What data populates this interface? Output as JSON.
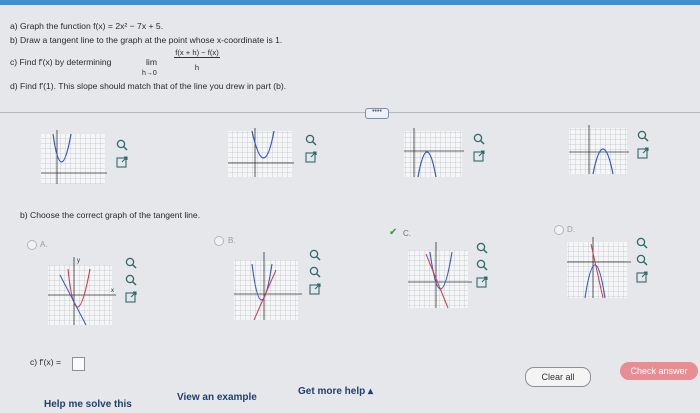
{
  "question": {
    "part_a": "a) Graph the function f(x) = 2x² − 7x + 5.",
    "part_b": "b) Draw a tangent line to the graph at the point whose x-coordinate is 1.",
    "part_c_prefix": "c) Find f′(x) by determining",
    "part_c_lim": "lim",
    "part_c_numerator": "f(x + h) − f(x)",
    "part_c_denominator": "h",
    "part_c_sub": "h→0",
    "part_d": "d) Find f′(1). This slope should match that of the line you drew in part (b)."
  },
  "dots_label": "••••",
  "part_b_prompt": "b) Choose the correct graph of the tangent line.",
  "options": [
    {
      "label": "A.",
      "selected": false
    },
    {
      "label": "B.",
      "selected": false
    },
    {
      "label": "C.",
      "selected": true
    },
    {
      "label": "D.",
      "selected": false
    }
  ],
  "check_mark": "✔",
  "axis_x": "x",
  "axis_y": "y",
  "part_c_answer_label": "c) f′(x) =",
  "buttons": {
    "clear_all": "Clear all",
    "check_answer": "Check answer"
  },
  "links": {
    "help_me_solve": "Help me solve this",
    "view_example": "View an example",
    "get_more_help": "Get more help ▴"
  },
  "icons": [
    "zoom-in-icon",
    "zoom-out-icon",
    "open-external-icon"
  ],
  "colors": {
    "accent": "#3d8fd0",
    "curve": "#d3394a",
    "line": "#3457c9",
    "check_answer_bg": "#e98d94"
  }
}
